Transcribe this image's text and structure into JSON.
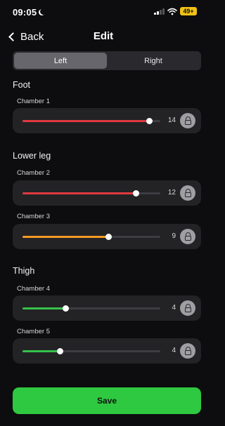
{
  "status": {
    "time": "09:05",
    "battery": "49+"
  },
  "nav": {
    "back_label": "Back",
    "title": "Edit"
  },
  "segment": {
    "options": [
      "Left",
      "Right"
    ],
    "selected": "Left"
  },
  "sections": [
    {
      "title": "Foot",
      "chambers": [
        {
          "label": "Chamber 1",
          "value": "14",
          "level": 0.92,
          "color": "#e03a3f"
        }
      ]
    },
    {
      "title": "Lower leg",
      "chambers": [
        {
          "label": "Chamber 2",
          "value": "12",
          "level": 0.82,
          "color": "#e03a3f"
        },
        {
          "label": "Chamber 3",
          "value": "9",
          "level": 0.62,
          "color": "#f59a23"
        }
      ]
    },
    {
      "title": "Thigh",
      "chambers": [
        {
          "label": "Chamber 4",
          "value": "4",
          "level": 0.31,
          "color": "#35c24a"
        },
        {
          "label": "Chamber 5",
          "value": "4",
          "level": 0.27,
          "color": "#35c24a"
        }
      ]
    }
  ],
  "save_label": "Save"
}
